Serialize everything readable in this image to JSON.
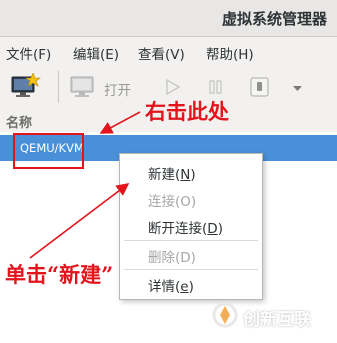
{
  "window": {
    "title": "虚拟系统管理器"
  },
  "menu": [
    {
      "label": "文件(F)"
    },
    {
      "label": "编辑(E)"
    },
    {
      "label": "查看(V)"
    },
    {
      "label": "帮助(H)"
    }
  ],
  "toolbar": {
    "open_label": "打开"
  },
  "list": {
    "column_header": "名称",
    "connection": "QEMU/KVM"
  },
  "context_menu": {
    "new_text": "新建(",
    "new_key": "N",
    "new_end": ")",
    "connect": "连接(O)",
    "disconnect_text": "断开连接(",
    "disconnect_key": "D",
    "disconnect_end": ")",
    "delete": "删除(D)",
    "details_text": "详情(",
    "details_key": "e",
    "details_end": ")"
  },
  "annotations": {
    "right_click": "右击此处",
    "click_new": "单击“新建”"
  },
  "watermark": {
    "text": "创新互联"
  },
  "colors": {
    "selection": "#4a90d9",
    "annotation": "#e3141c"
  },
  "icons": [
    "monitor-star-icon",
    "monitor-icon",
    "play-icon",
    "pause-icon",
    "power-icon",
    "dropdown-arrow-icon",
    "watermark-logo-icon"
  ]
}
